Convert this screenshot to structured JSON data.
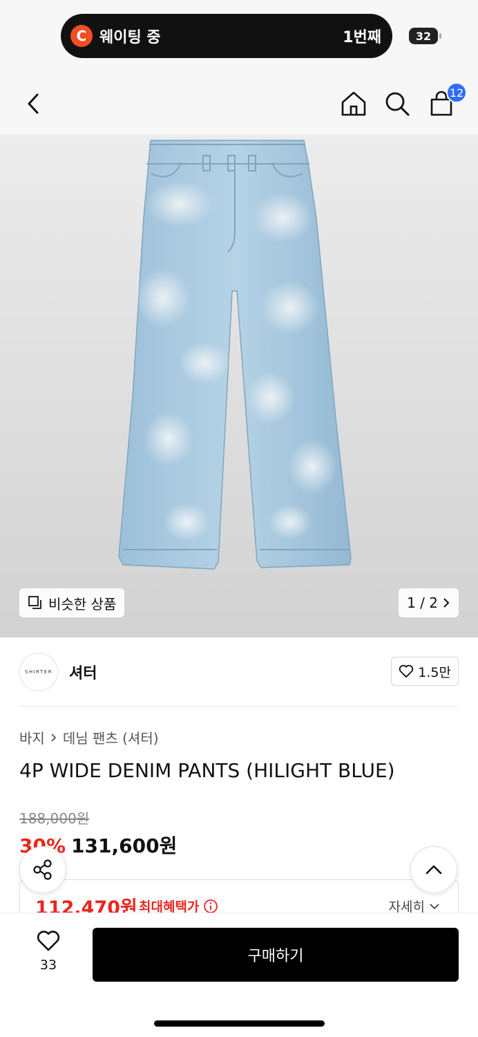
{
  "status_bar": {
    "waiting_logo": "C",
    "waiting_text": "웨이팅 중",
    "waiting_count": "1번째",
    "battery": "32"
  },
  "header": {
    "back_icon": "chevron-left-icon",
    "home_icon": "home-icon",
    "search_icon": "search-icon",
    "cart_icon": "shopping-bag-icon",
    "cart_badge": "12",
    "accent_color": "#2f6df6"
  },
  "image": {
    "similar_label": "비슷한 상품",
    "pager": "1 / 2"
  },
  "brand": {
    "logo_text": "SHIRTER",
    "name": "셔터",
    "likes": "1.5만"
  },
  "product": {
    "breadcrumb": [
      "바지",
      "데님 팬츠 (셔터)"
    ],
    "title": "4P WIDE DENIM PANTS (HILIGHT BLUE)",
    "original_price": "188,000원",
    "discount": "30%",
    "sale_price": "131,600원",
    "sale_color": "#e8261f"
  },
  "benefit": {
    "price": "112,470원",
    "label": "최대혜택가",
    "more": "자세히"
  },
  "bottom": {
    "like_count": "33",
    "buy_label": "구매하기"
  }
}
